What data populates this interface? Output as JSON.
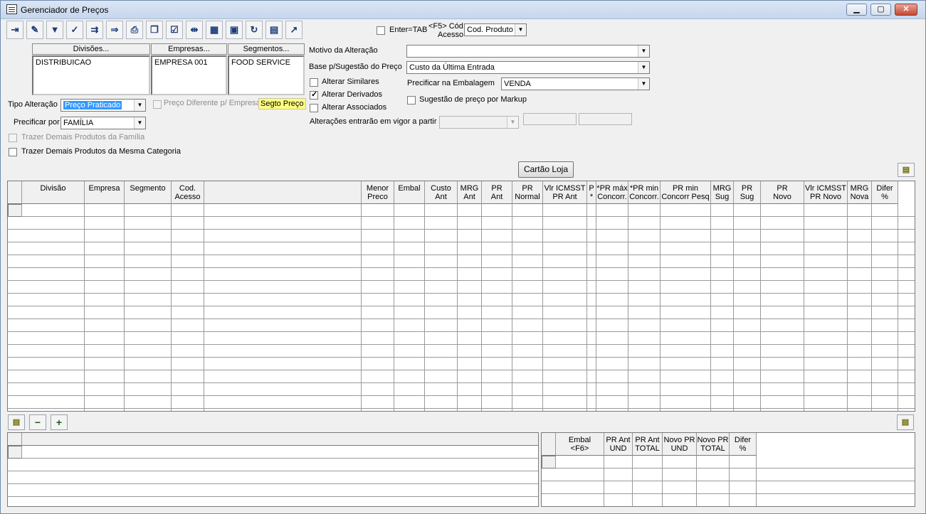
{
  "window": {
    "title": "Gerenciador de Preços",
    "controls": {
      "minimize": "▁",
      "maximize": "▢",
      "close": "✕"
    }
  },
  "toolbar": {
    "buttons": [
      {
        "name": "exit-icon",
        "glyph": "⇥"
      },
      {
        "name": "eraser-icon",
        "glyph": "✎"
      },
      {
        "name": "filter-icon",
        "glyph": "▼"
      },
      {
        "name": "filter-check-icon",
        "glyph": "✓"
      },
      {
        "name": "import-icon",
        "glyph": "⇉"
      },
      {
        "name": "export-icon",
        "glyph": "⇒"
      },
      {
        "name": "print-icon",
        "glyph": "⎙"
      },
      {
        "name": "copy-icon",
        "glyph": "❐"
      },
      {
        "name": "checklist-icon",
        "glyph": "☑"
      },
      {
        "name": "ruler-icon",
        "glyph": "⇹"
      },
      {
        "name": "grid-icon",
        "glyph": "▦"
      },
      {
        "name": "save-icon",
        "glyph": "▣"
      },
      {
        "name": "refresh-icon",
        "glyph": "↻"
      },
      {
        "name": "calculator-icon",
        "glyph": "▤"
      },
      {
        "name": "chart-icon",
        "glyph": "↗"
      }
    ],
    "enter_tab_label": "Enter=TAB",
    "f5_label": "<F5> Cód",
    "f5_label2": "Acesso",
    "cod_select": "Cod. Produto"
  },
  "filters": {
    "divisoes_btn": "Divisões...",
    "empresas_btn": "Empresas...",
    "segmentos_btn": "Segmentos...",
    "divisoes_val": "DISTRIBUICAO",
    "empresas_val": "EMPRESA 001",
    "segmentos_val": "FOOD SERVICE",
    "tipo_alteracao_label": "Tipo Alteração",
    "tipo_alteracao_val": "Preço Praticado",
    "preco_diferente_label": "Preço Diferente p/ Empresa",
    "segto_preco_label": "Segto Preço",
    "precificar_por_label": "Precificar por",
    "precificar_por_val": "FAMÍLIA",
    "trazer_familia_label": "Trazer Demais Produtos da Família",
    "trazer_categoria_label": "Trazer Demais Produtos da Mesma Categoria"
  },
  "right_form": {
    "motivo_label": "Motivo da Alteração",
    "motivo_val": "",
    "base_label": "Base p/Sugestão do Preço",
    "base_val": "Custo da Última Entrada",
    "alterar_similares": "Alterar Similares",
    "alterar_derivados": "Alterar Derivados",
    "alterar_associados": "Alterar Associados",
    "precificar_embalagem_label": "Precificar na Embalagem",
    "precificar_embalagem_val": "VENDA",
    "sugestao_markup_label": "Sugestão de preço por Markup",
    "alteracoes_label": "Alterações entrarão em vigor a partir"
  },
  "cartao_loja_btn": "Cartão Loja",
  "main_grid": {
    "columns": [
      "Divisão",
      "Empresa",
      "Segmento",
      "Cod.\nAcesso",
      "",
      "Menor\nPreco",
      "Embal",
      "Custo\nAnt",
      "MRG\nAnt",
      "PR\nAnt",
      "PR\nNormal",
      "Vlr ICMSST\nPR Ant",
      "P\n*",
      "*PR máx\nConcorr.",
      "*PR min\nConcorr.",
      "PR min\nConcorr Pesq",
      "MRG\nSug",
      "PR Sug",
      "PR\nNovo",
      "Vlr ICMSST\nPR Novo",
      "MRG\nNova",
      "Difer\n%"
    ]
  },
  "bottom_toolbar": {
    "minus": "−",
    "plus": "+"
  },
  "detail_grid": {
    "columns": [
      "Embal\n<F6>",
      "PR Ant\nUND",
      "PR Ant\nTOTAL",
      "Novo PR\nUND",
      "Novo PR\nTOTAL",
      "Difer\n%"
    ]
  }
}
